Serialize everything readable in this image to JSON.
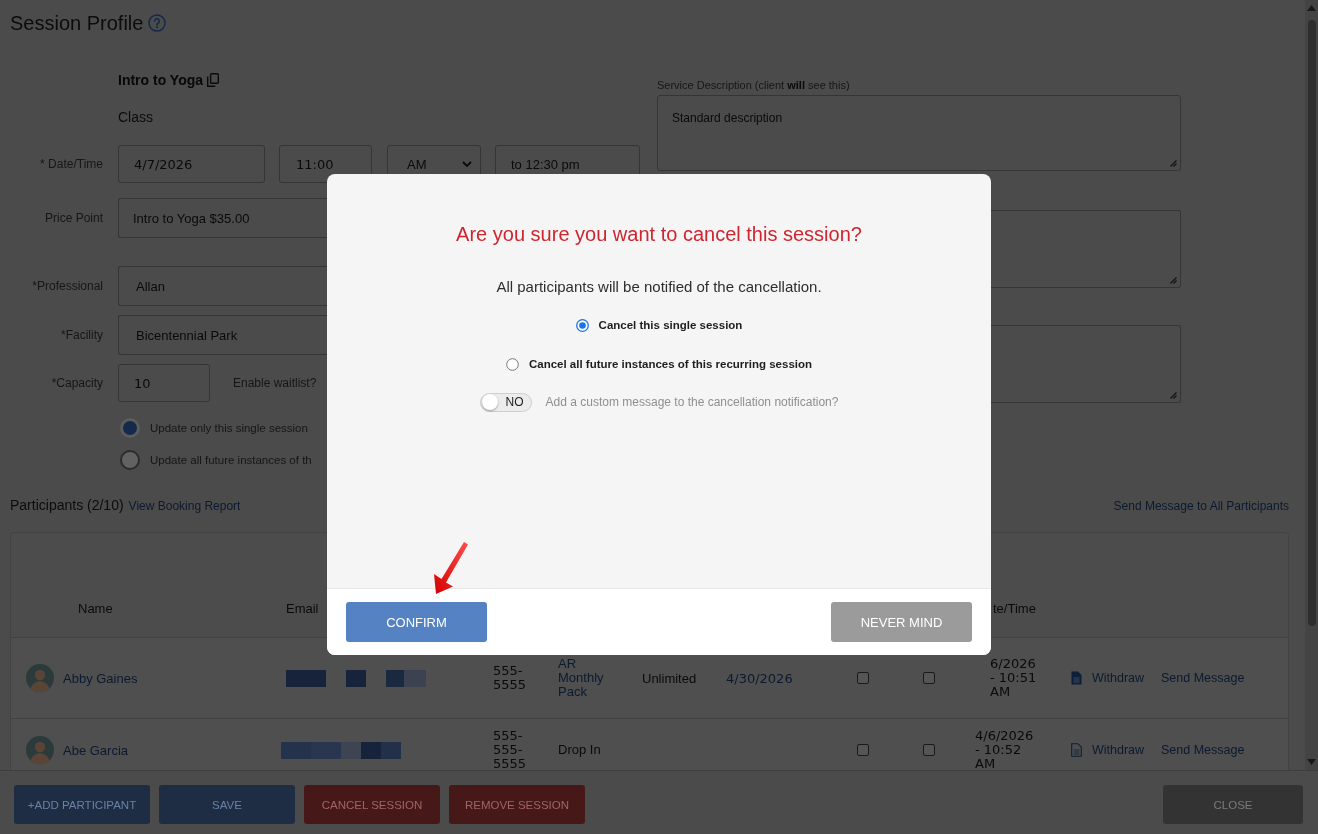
{
  "page": {
    "title": "Session Profile"
  },
  "session": {
    "name": "Intro to Yoga",
    "type": "Class"
  },
  "form": {
    "date_time": {
      "label": "* Date/Time",
      "date": "4/7/2026",
      "start_time": "11:00",
      "meridiem": "AM",
      "end_time": "to 12:30 pm"
    },
    "price_point": {
      "label": "Price Point",
      "value": "Intro to Yoga $35.00"
    },
    "professional": {
      "label": "*Professional",
      "value": "Allan"
    },
    "facility": {
      "label": "*Facility",
      "value": "Bicentennial Park"
    },
    "capacity": {
      "label": "*Capacity",
      "value": "10",
      "waitlist_label": "Enable waitlist?"
    },
    "update_scope": [
      {
        "label": "Update only this single session",
        "selected": true
      },
      {
        "label": "Update all future instances of th",
        "selected": false
      }
    ]
  },
  "service_description": {
    "label": "Service Description (client **will** see this)",
    "value": "Standard description"
  },
  "participants": {
    "title": "Participants (2/10)",
    "report_link": "View Booking Report",
    "message_all_link": "Send Message to All Participants"
  },
  "table": {
    "columns": {
      "name": "Name",
      "email": "Email",
      "column_9": "te/Time"
    },
    "rows": [
      {
        "name": "Abby Gaines",
        "column_3": "555-5555",
        "column_4": {
          "text": "AR Monthly Pack",
          "link": true
        },
        "column_5": "Unlimited",
        "column_6": "4/30/2026",
        "column_7": false,
        "column_8": false,
        "column_9": "6/2026 - 10:51 AM",
        "document_filled": true,
        "column_11": "Withdraw",
        "column_12": "Send Message"
      },
      {
        "name": "Abe Garcia",
        "column_3": "555-555-5555",
        "column_4": {
          "text": "Drop In",
          "link": false
        },
        "column_7": false,
        "column_8": false,
        "column_9": "4/6/2026 - 10:52 AM",
        "document_filled": false,
        "column_11": "Withdraw",
        "column_12": "Send Message"
      }
    ]
  },
  "footer_buttons": [
    {
      "label": "+ADD PARTICIPANT",
      "kind": "primary"
    },
    {
      "label": "SAVE",
      "kind": "primary"
    },
    {
      "label": "CANCEL SESSION",
      "kind": "danger"
    },
    {
      "label": "REMOVE SESSION",
      "kind": "danger"
    },
    {
      "label": "CLOSE",
      "kind": "close"
    }
  ],
  "dialog": {
    "title": "Are you sure you want to cancel this session?",
    "message": "All participants will be notified of the cancellation.",
    "options": [
      {
        "label": "Cancel this single session",
        "selected": true
      },
      {
        "label": "Cancel all future instances of this recurring session",
        "selected": false
      }
    ],
    "custom_message_toggle": {
      "on": false,
      "state_label": "NO",
      "label": "Add a custom message to the cancellation notification?"
    },
    "buttons": [
      {
        "label": "CONFIRM",
        "kind": "primary"
      },
      {
        "label": "NEVER MIND",
        "kind": "secondary"
      }
    ]
  }
}
